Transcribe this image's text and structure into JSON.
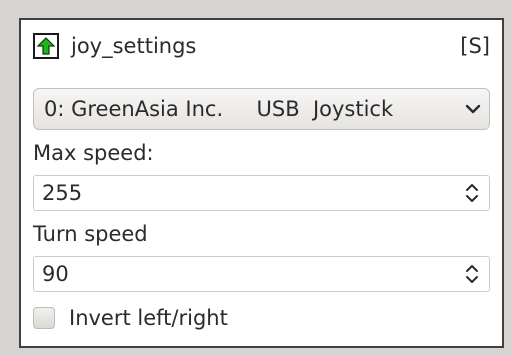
{
  "panel": {
    "title": "joy_settings",
    "shortcut": "[S]",
    "icon": "green-up-arrow-icon"
  },
  "joystick_select": {
    "value": "0: GreenAsia Inc.     USB  Joystick"
  },
  "max_speed": {
    "label": "Max speed:",
    "value": "255"
  },
  "turn_speed": {
    "label": "Turn speed",
    "value": "90"
  },
  "invert": {
    "label": "Invert left/right",
    "checked": false
  },
  "colors": {
    "icon_arrow": "#1fb51f",
    "window_bg": "#d6d3d1",
    "panel_border": "#404040"
  }
}
